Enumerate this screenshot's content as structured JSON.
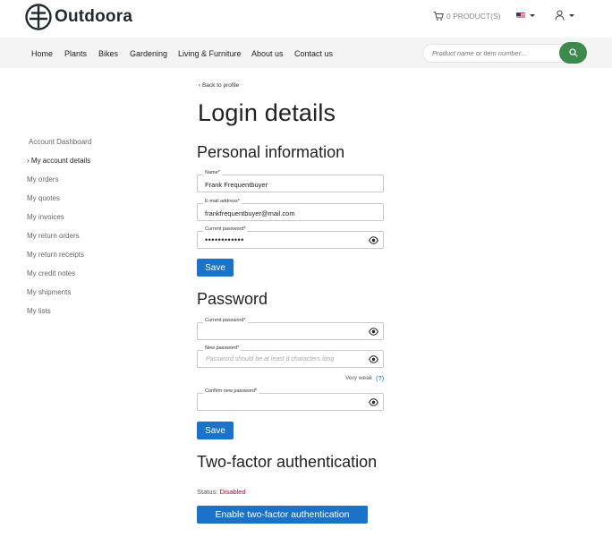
{
  "header": {
    "brand": "Outdoora",
    "cart_label": "0 PRODUCT(S)",
    "language_icon": "us-flag-icon",
    "user_icon": "user-icon"
  },
  "nav": {
    "items": [
      "Home",
      "Plants",
      "Bikes",
      "Gardening",
      "Living & Furniture",
      "About us",
      "Contact us"
    ],
    "search_placeholder": "Product name or item number..."
  },
  "sidebar": {
    "items": [
      "Account Dashboard",
      "My account details",
      "My orders",
      "My quotes",
      "My invoices",
      "My return orders",
      "My return receipts",
      "My credit notes",
      "My shipments",
      "My lists"
    ],
    "active_marker": "›"
  },
  "main": {
    "back_link": "‹ Back to profile",
    "title": "Login details",
    "personal": {
      "heading": "Personal information",
      "name_label": "Name*",
      "name_value": "Frank Frequentbuyer",
      "email_label": "E-mail address*",
      "email_value": "frankfrequentbuyer@mail.com",
      "current_password_label": "Current password*",
      "current_password_value": "••••••••••••",
      "save_label": "Save"
    },
    "password": {
      "heading": "Password",
      "current_password_label": "Current password*",
      "new_password_label": "New password*",
      "new_password_placeholder": "Password should be at least 8 characters long",
      "strength_label": "Very weak",
      "help_label": "(?)",
      "confirm_password_label": "Confirm new password*",
      "save_label": "Save"
    },
    "twofa": {
      "heading": "Two-factor authentication",
      "status_label": "Status:",
      "status_value": "Disabled",
      "enable_label": "Enable two-factor authentication"
    }
  },
  "colors": {
    "primary_button": "#1a73c8",
    "search_button": "#3c8a4c",
    "status_disabled": "#d0021b",
    "nav_background": "#f4f4f4"
  }
}
